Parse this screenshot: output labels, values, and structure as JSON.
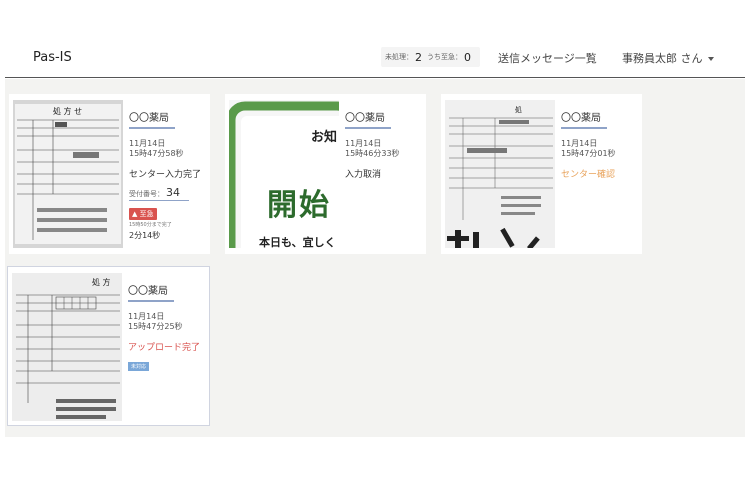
{
  "header": {
    "brand": "Pas-IS",
    "counter_unprocessed_label": "未処理：",
    "counter_unprocessed_value": "2",
    "counter_urgent_label": "うち至急：",
    "counter_urgent_value": "0",
    "sent_messages_link": "送信メッセージ一覧",
    "user_menu": "事務員太郎 さん"
  },
  "cards": [
    {
      "pharmacy": "〇〇薬局",
      "date": "11月14日",
      "time": "15時47分58秒",
      "status": "センター入力完了",
      "receipt_label": "受付番号：",
      "receipt_number": "34",
      "alert_label": "至急",
      "alert_note": "15時50分まで完了",
      "elapsed": "2分14秒"
    },
    {
      "pharmacy": "〇〇薬局",
      "date": "11月14日",
      "time": "15時46分33秒",
      "status": "入力取消",
      "thumb_text_top": "お知",
      "thumb_text_main": "開始",
      "thumb_text_bottom": "本日も、宜しく"
    },
    {
      "pharmacy": "〇〇薬局",
      "date": "11月14日",
      "time": "15時47分01秒",
      "status": "センター確認"
    },
    {
      "pharmacy": "〇〇薬局",
      "date": "11月14日",
      "time": "15時47分25秒",
      "status": "アップロード完了",
      "badge": "未対応"
    }
  ],
  "colors": {
    "status_orange": "#e8a25a",
    "status_red": "#d9534f",
    "underline_blue": "#8fa3c8",
    "alert_red": "#d9534f",
    "background": "#f3f3f1"
  }
}
